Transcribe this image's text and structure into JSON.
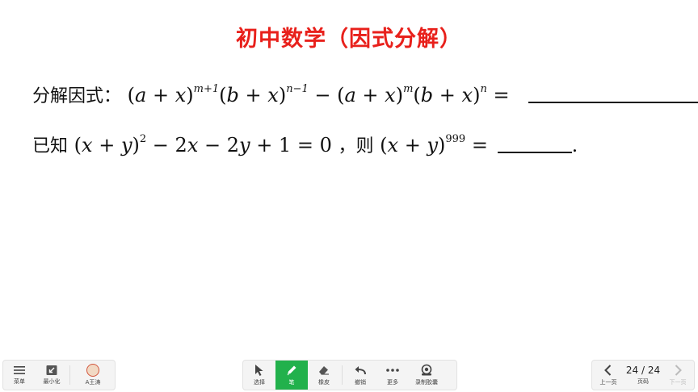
{
  "title": "初中数学（因式分解）",
  "problem1": {
    "label": "分解因式：",
    "expr": [
      "(",
      "a",
      " + ",
      "x",
      ")",
      "m+1",
      "(",
      "b",
      " + ",
      "x",
      ")",
      "n−1",
      " − (",
      "a",
      " + ",
      "x",
      ")",
      "m",
      "(",
      "b",
      " + ",
      "x",
      ")",
      "n",
      " ="
    ],
    "end": "."
  },
  "problem2": {
    "label": "已知",
    "expr_a": [
      "(",
      "x",
      " + ",
      "y",
      ")",
      "2",
      " − 2",
      "x",
      " − 2",
      "y",
      " + 1 = 0"
    ],
    "comma": "，",
    "label_then": "则",
    "expr_b": [
      "(",
      "x",
      " + ",
      "y",
      ")",
      "999",
      " ="
    ],
    "end": "."
  },
  "toolbar": {
    "left": [
      {
        "label": "菜单",
        "icon": "menu-icon"
      },
      {
        "label": "最小化",
        "icon": "minimize-icon"
      },
      {
        "label": "A王涛",
        "icon": "avatar-icon"
      }
    ],
    "middle": [
      {
        "label": "选择",
        "icon": "cursor-icon"
      },
      {
        "label": "笔",
        "icon": "pen-icon",
        "active": true
      },
      {
        "label": "橡皮",
        "icon": "eraser-icon"
      },
      {
        "label": "撤销",
        "icon": "undo-icon"
      },
      {
        "label": "更多",
        "icon": "more-icon"
      },
      {
        "label": "录制胶囊",
        "icon": "record-icon"
      }
    ],
    "right": {
      "prev_label": "上一页",
      "page_text": "24 / 24",
      "page_label": "页码",
      "next_label": "下一页"
    }
  },
  "colors": {
    "title": "#e8201b",
    "active_tool": "#22b14c"
  }
}
